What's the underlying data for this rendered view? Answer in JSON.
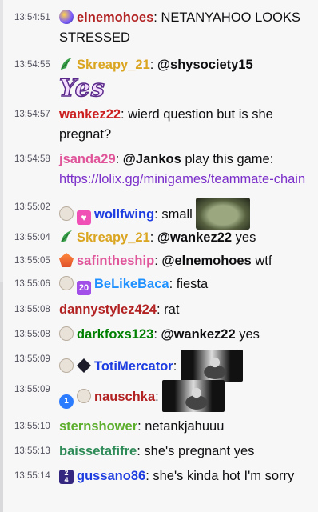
{
  "colors": {
    "timestamp": "#53535f",
    "link": "#7b2fc9"
  },
  "messages": [
    {
      "ts": "13:54:51",
      "badges": [
        "badge-orb-icon"
      ],
      "user": "elnemohoes",
      "color": "#b22222",
      "text": "NETANYAHOO LOOKS STRESSED"
    },
    {
      "ts": "13:54:55",
      "badges": [
        "leaf-badge-icon"
      ],
      "user": "Skreapy_21",
      "color": "#daa520",
      "mention": "@shysociety15",
      "emote": "Yes"
    },
    {
      "ts": "13:54:57",
      "user": "wankez22",
      "color": "#cc1f1f",
      "text": "wierd question but is she pregnat?"
    },
    {
      "ts": "13:54:58",
      "user": "jsanda29",
      "color": "#e0559a",
      "mention": "@Jankos",
      "text": "play this game:",
      "link": "https://lolix.gg/minigames/teammate-chain"
    },
    {
      "ts": "13:55:02",
      "badges": [
        "face-badge-icon",
        "heart-badge-icon"
      ],
      "user": "wollfwing",
      "color": "#1e3de0",
      "text": "small",
      "emote": "frog-emote"
    },
    {
      "ts": "13:55:04",
      "badges": [
        "leaf-badge-icon"
      ],
      "user": "Skreapy_21",
      "color": "#daa520",
      "mention": "@wankez22",
      "text": "yes"
    },
    {
      "ts": "13:55:05",
      "badges": [
        "flame-badge-icon"
      ],
      "user": "safintheship",
      "color": "#e0559a",
      "mention": "@elnemohoes",
      "text": "wtf"
    },
    {
      "ts": "13:55:06",
      "badges": [
        "face-badge-icon",
        "twenty-badge-icon"
      ],
      "badge_text": "20",
      "user": "BeLikeBaca",
      "color": "#1e90ff",
      "text": "fiesta"
    },
    {
      "ts": "13:55:08",
      "user": "dannystylez424",
      "color": "#b22222",
      "text": "rat"
    },
    {
      "ts": "13:55:08",
      "badges": [
        "face-badge-icon"
      ],
      "user": "darkfoxs123",
      "color": "#008000",
      "mention": "@wankez22",
      "text": "yes"
    },
    {
      "ts": "13:55:09",
      "badges": [
        "face-badge-icon",
        "ninja-badge-icon"
      ],
      "user": "TotiMercator",
      "color": "#1e3de0",
      "emote": "joker-emote"
    },
    {
      "ts": "13:55:09",
      "badges": [
        "blue-badge-icon",
        "face-badge-icon"
      ],
      "user": "nauschka",
      "color": "#b22222",
      "emote": "joker-emote"
    },
    {
      "ts": "13:55:10",
      "user": "sternshower",
      "color": "#5cae2c",
      "text": "netankjahuuu"
    },
    {
      "ts": "13:55:13",
      "user": "baissetafifre",
      "color": "#2e8b57",
      "text": "she's pregnant yes"
    },
    {
      "ts": "13:55:14",
      "badges": [
        "twentyfour-badge-icon"
      ],
      "badge_text": "24",
      "user": "gussano86",
      "color": "#1e3de0",
      "text": "she's kinda hot I'm sorry"
    }
  ]
}
